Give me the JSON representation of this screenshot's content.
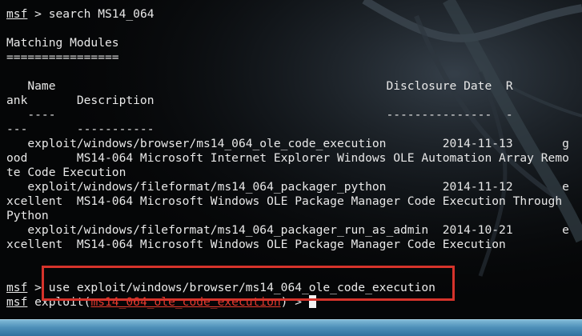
{
  "window": {
    "background_color": "#050607",
    "text_color": "#e8e8e8",
    "highlight_color": "#d6332b"
  },
  "terminal": {
    "lines": [
      {
        "prompt": "msf",
        "text": " > search MS14_064"
      },
      {
        "text": ""
      },
      {
        "text": "Matching Modules"
      },
      {
        "text": "================"
      },
      {
        "text": ""
      },
      {
        "text": "   Name                                               Disclosure Date  R"
      },
      {
        "text": "ank       Description"
      },
      {
        "text": "   ----                                               ---------------  -"
      },
      {
        "text": "---       -----------"
      },
      {
        "text": "   exploit/windows/browser/ms14_064_ole_code_execution        2014-11-13       g"
      },
      {
        "text": "ood       MS14-064 Microsoft Internet Explorer Windows OLE Automation Array Remo"
      },
      {
        "text": "te Code Execution"
      },
      {
        "text": "   exploit/windows/fileformat/ms14_064_packager_python        2014-11-12       e"
      },
      {
        "text": "xcellent  MS14-064 Microsoft Windows OLE Package Manager Code Execution Through"
      },
      {
        "text": "Python"
      },
      {
        "text": "   exploit/windows/fileformat/ms14_064_packager_run_as_admin  2014-10-21       e"
      },
      {
        "text": "xcellent  MS14-064 Microsoft Windows OLE Package Manager Code Execution"
      },
      {
        "text": ""
      },
      {
        "text": ""
      },
      {
        "prompt": "msf",
        "text": " > use exploit/windows/browser/ms14_064_ole_code_execution"
      }
    ],
    "final_prompt": {
      "prompt": "msf",
      "before_module": " exploit(",
      "module": "ms14_064_ole_code_execution",
      "after_module": ") > "
    }
  },
  "icons": {
    "cursor": "block-cursor-icon",
    "background": "kali-dragon-background-icon"
  }
}
